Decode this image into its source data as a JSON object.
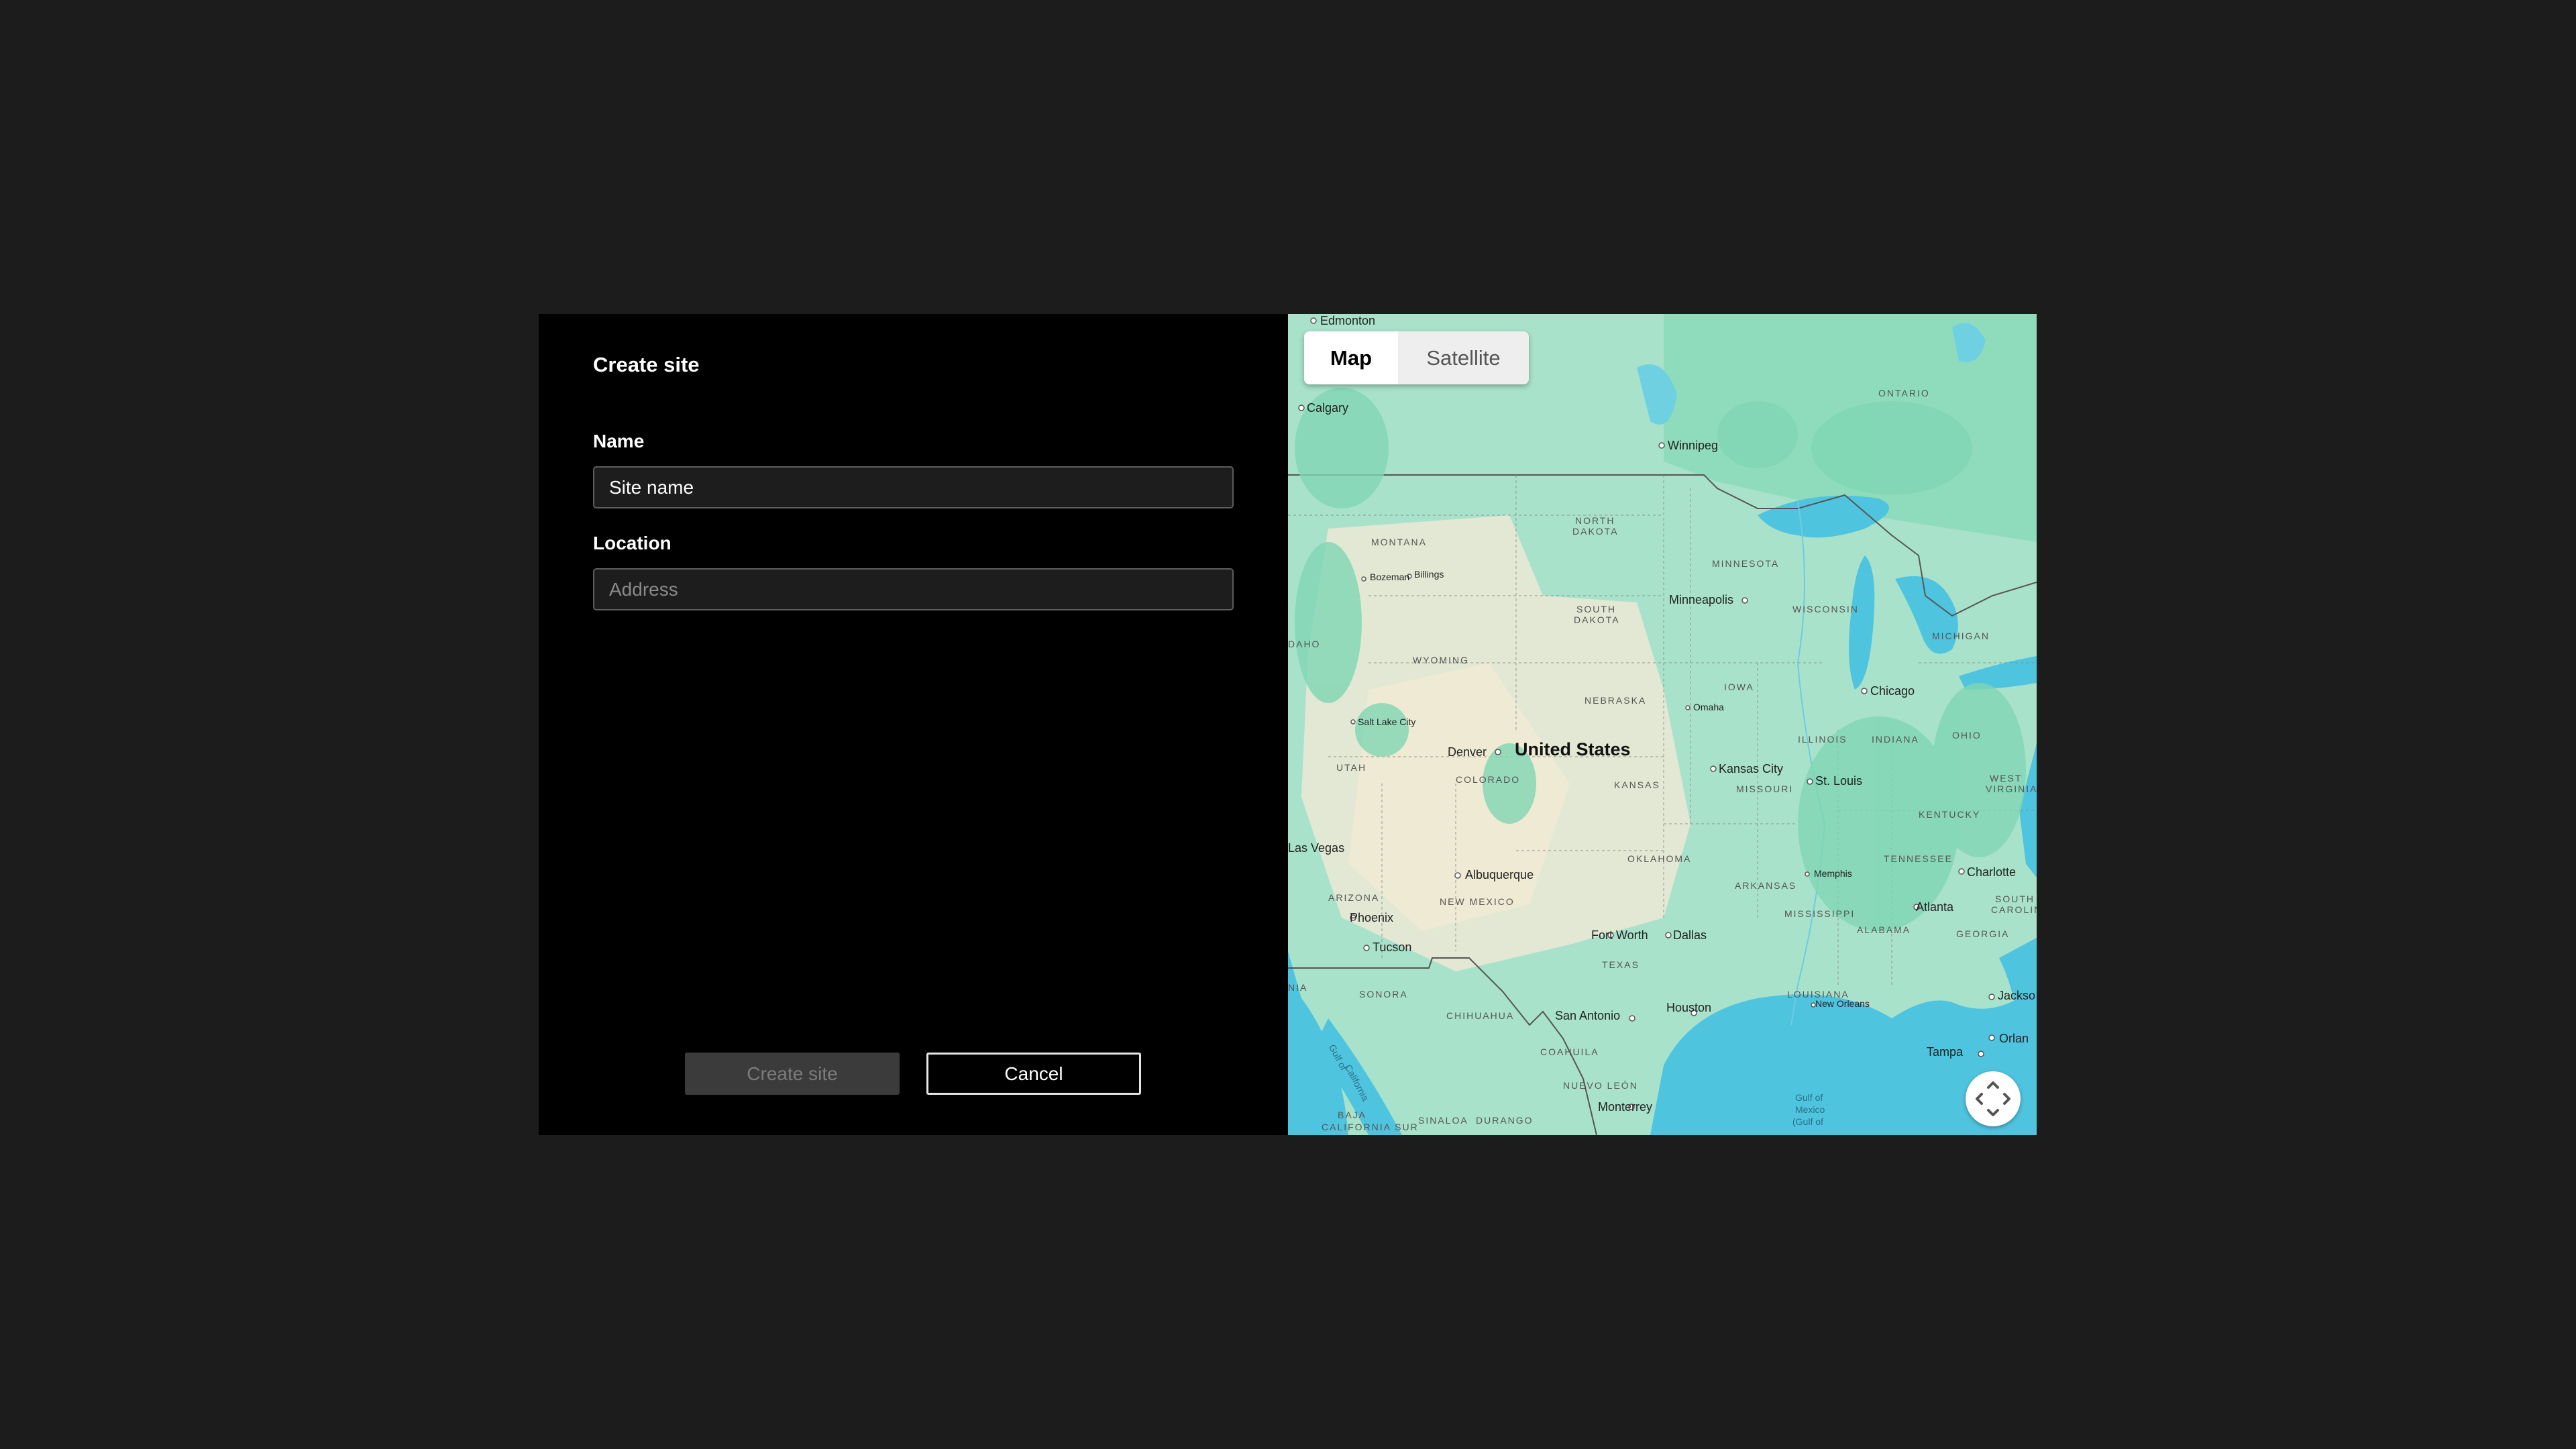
{
  "dialog": {
    "title": "Create site",
    "name_label": "Name",
    "name_value": "Site name",
    "location_label": "Location",
    "location_placeholder": "Address",
    "create_label": "Create site",
    "cancel_label": "Cancel"
  },
  "map": {
    "toggle": {
      "map_label": "Map",
      "satellite_label": "Satellite",
      "selected": "Map"
    },
    "recenter_icon": "recenter-arrows-icon",
    "country": "United States",
    "cities": {
      "edmonton": "Edmonton",
      "calgary": "Calgary",
      "winnipeg": "Winnipeg",
      "bozeman": "Bozeman",
      "billings": "Billings",
      "minneapolis": "Minneapolis",
      "salt_lake_city": "Salt Lake City",
      "denver": "Denver",
      "omaha": "Omaha",
      "chicago": "Chicago",
      "kansas_city": "Kansas City",
      "st_louis": "St. Louis",
      "las_vegas": "Las Vegas",
      "albuquerque": "Albuquerque",
      "memphis": "Memphis",
      "charlotte": "Charlotte",
      "atlanta": "Atlanta",
      "phoenix": "Phoenix",
      "tucson": "Tucson",
      "fort_worth": "Fort Worth",
      "dallas": "Dallas",
      "houston": "Houston",
      "san_antonio": "San Antonio",
      "new_orleans": "New Orleans",
      "jacksonville": "Jackso",
      "tampa": "Tampa",
      "orlando": "Orlan",
      "monterrey": "Monterrey"
    },
    "states": {
      "ontario": "ONTARIO",
      "north_dakota_1": "NORTH",
      "north_dakota_2": "DAKOTA",
      "montana": "MONTANA",
      "minnesota": "MINNESOTA",
      "south_dakota_1": "SOUTH",
      "south_dakota_2": "DAKOTA",
      "wisconsin": "WISCONSIN",
      "michigan": "MICHIGAN",
      "idaho": "DAHO",
      "wyoming": "WYOMING",
      "iowa": "IOWA",
      "nebraska": "NEBRASKA",
      "illinois": "ILLINOIS",
      "indiana": "INDIANA",
      "ohio": "OHIO",
      "utah": "UTAH",
      "colorado": "COLORADO",
      "kansas": "KANSAS",
      "missouri": "MISSOURI",
      "west_virginia_1": "WEST",
      "west_virginia_2": "VIRGINIA",
      "kentucky": "KENTUCKY",
      "oklahoma": "OKLAHOMA",
      "tennessee": "TENNESSEE",
      "arizona": "ARIZONA",
      "new_mexico": "NEW MEXICO",
      "arkansas": "ARKANSAS",
      "mississippi": "MISSISSIPPI",
      "south_carolina_1": "SOUTH",
      "south_carolina_2": "CAROLINA",
      "alabama": "ALABAMA",
      "georgia": "GEORGIA",
      "texas": "TEXAS",
      "louisiana": "LOUISIANA",
      "california_short": "NIA",
      "sonora": "SONORA",
      "chihuahua": "CHIHUAHUA",
      "coahuila": "COAHUILA",
      "nuevo_leon": "NUEVO LEÓN",
      "baja_california_sur_1": "BAJA",
      "baja_california_sur_2": "CALIFORNIA SUR",
      "sinaloa": "SINALOA",
      "durango": "DURANGO"
    },
    "water": {
      "gulf_california_1": "Gulf of",
      "gulf_california_2": "California",
      "gulf_mexico_1": "Gulf of",
      "gulf_mexico_2": "Mexico",
      "gulf_mexico_3": "(Gulf of"
    }
  }
}
